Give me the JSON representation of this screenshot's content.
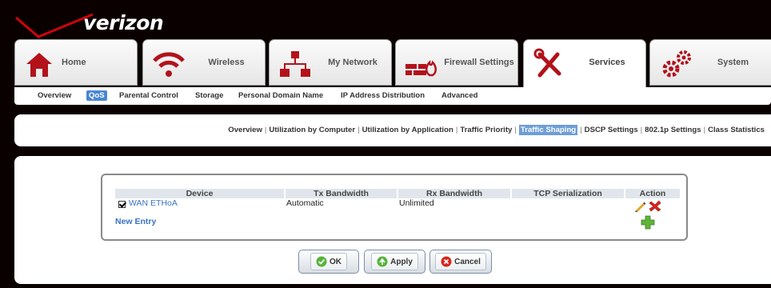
{
  "header": {
    "logo": "verizon"
  },
  "main_tabs": [
    {
      "label": "Home",
      "icon": "home-icon"
    },
    {
      "label": "Wireless",
      "icon": "wifi-icon"
    },
    {
      "label": "My Network",
      "icon": "network-icon"
    },
    {
      "label": "Firewall Settings",
      "icon": "firewall-icon"
    },
    {
      "label": "Services",
      "icon": "tools-icon",
      "active": true
    },
    {
      "label": "System",
      "icon": "gears-icon"
    }
  ],
  "sub_nav": [
    {
      "label": "Overview"
    },
    {
      "label": "QoS",
      "active": true
    },
    {
      "label": "Parental Control"
    },
    {
      "label": "Storage"
    },
    {
      "label": "Personal Domain Name"
    },
    {
      "label": "IP Address Distribution"
    },
    {
      "label": "Advanced"
    }
  ],
  "secondary_nav": [
    {
      "label": "Overview"
    },
    {
      "label": "Utilization by Computer"
    },
    {
      "label": "Utilization by Application"
    },
    {
      "label": "Traffic Priority"
    },
    {
      "label": "Traffic Shaping",
      "active": true
    },
    {
      "label": "DSCP Settings"
    },
    {
      "label": "802.1p Settings"
    },
    {
      "label": "Class Statistics"
    }
  ],
  "table": {
    "headers": [
      "Device",
      "Tx Bandwidth",
      "Rx Bandwidth",
      "TCP Serialization",
      "Action"
    ],
    "rows": [
      {
        "checked": true,
        "device": "WAN ETHoA",
        "tx": "Automatic",
        "rx": "Unlimited",
        "tcp": ""
      }
    ],
    "new_entry": "New Entry"
  },
  "buttons": {
    "ok": "OK",
    "apply": "Apply",
    "cancel": "Cancel"
  },
  "colors": {
    "brand_red": "#cd040b",
    "accent_blue": "#4a86d4",
    "link_blue": "#3a73c4"
  }
}
